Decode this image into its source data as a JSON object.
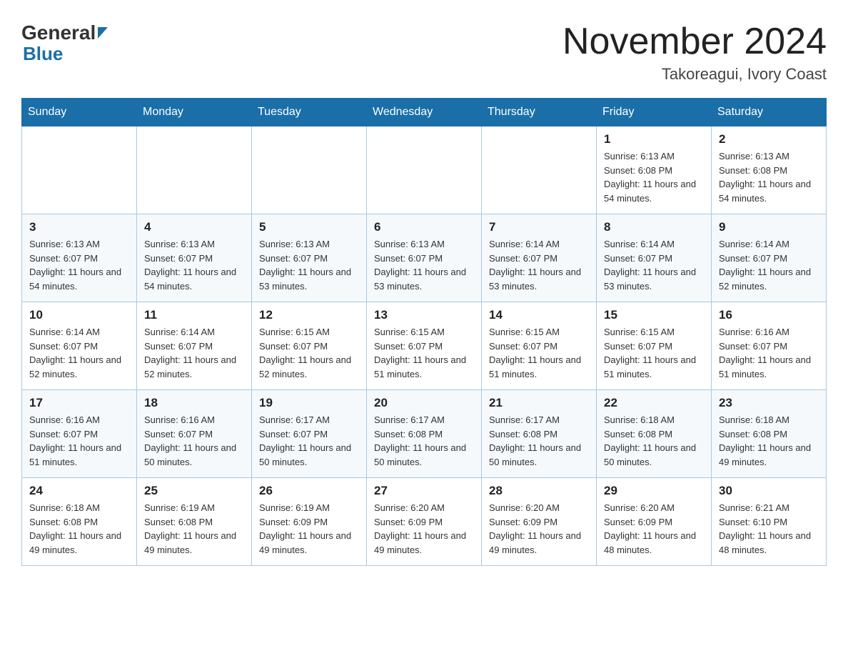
{
  "logo": {
    "general_text": "General",
    "blue_text": "Blue",
    "triangle_color": "#1a6fa8"
  },
  "header": {
    "month_year": "November 2024",
    "location": "Takoreagui, Ivory Coast"
  },
  "weekdays": [
    "Sunday",
    "Monday",
    "Tuesday",
    "Wednesday",
    "Thursday",
    "Friday",
    "Saturday"
  ],
  "weeks": [
    [
      {
        "day": "",
        "sunrise": "",
        "sunset": "",
        "daylight": ""
      },
      {
        "day": "",
        "sunrise": "",
        "sunset": "",
        "daylight": ""
      },
      {
        "day": "",
        "sunrise": "",
        "sunset": "",
        "daylight": ""
      },
      {
        "day": "",
        "sunrise": "",
        "sunset": "",
        "daylight": ""
      },
      {
        "day": "",
        "sunrise": "",
        "sunset": "",
        "daylight": ""
      },
      {
        "day": "1",
        "sunrise": "Sunrise: 6:13 AM",
        "sunset": "Sunset: 6:08 PM",
        "daylight": "Daylight: 11 hours and 54 minutes."
      },
      {
        "day": "2",
        "sunrise": "Sunrise: 6:13 AM",
        "sunset": "Sunset: 6:08 PM",
        "daylight": "Daylight: 11 hours and 54 minutes."
      }
    ],
    [
      {
        "day": "3",
        "sunrise": "Sunrise: 6:13 AM",
        "sunset": "Sunset: 6:07 PM",
        "daylight": "Daylight: 11 hours and 54 minutes."
      },
      {
        "day": "4",
        "sunrise": "Sunrise: 6:13 AM",
        "sunset": "Sunset: 6:07 PM",
        "daylight": "Daylight: 11 hours and 54 minutes."
      },
      {
        "day": "5",
        "sunrise": "Sunrise: 6:13 AM",
        "sunset": "Sunset: 6:07 PM",
        "daylight": "Daylight: 11 hours and 53 minutes."
      },
      {
        "day": "6",
        "sunrise": "Sunrise: 6:13 AM",
        "sunset": "Sunset: 6:07 PM",
        "daylight": "Daylight: 11 hours and 53 minutes."
      },
      {
        "day": "7",
        "sunrise": "Sunrise: 6:14 AM",
        "sunset": "Sunset: 6:07 PM",
        "daylight": "Daylight: 11 hours and 53 minutes."
      },
      {
        "day": "8",
        "sunrise": "Sunrise: 6:14 AM",
        "sunset": "Sunset: 6:07 PM",
        "daylight": "Daylight: 11 hours and 53 minutes."
      },
      {
        "day": "9",
        "sunrise": "Sunrise: 6:14 AM",
        "sunset": "Sunset: 6:07 PM",
        "daylight": "Daylight: 11 hours and 52 minutes."
      }
    ],
    [
      {
        "day": "10",
        "sunrise": "Sunrise: 6:14 AM",
        "sunset": "Sunset: 6:07 PM",
        "daylight": "Daylight: 11 hours and 52 minutes."
      },
      {
        "day": "11",
        "sunrise": "Sunrise: 6:14 AM",
        "sunset": "Sunset: 6:07 PM",
        "daylight": "Daylight: 11 hours and 52 minutes."
      },
      {
        "day": "12",
        "sunrise": "Sunrise: 6:15 AM",
        "sunset": "Sunset: 6:07 PM",
        "daylight": "Daylight: 11 hours and 52 minutes."
      },
      {
        "day": "13",
        "sunrise": "Sunrise: 6:15 AM",
        "sunset": "Sunset: 6:07 PM",
        "daylight": "Daylight: 11 hours and 51 minutes."
      },
      {
        "day": "14",
        "sunrise": "Sunrise: 6:15 AM",
        "sunset": "Sunset: 6:07 PM",
        "daylight": "Daylight: 11 hours and 51 minutes."
      },
      {
        "day": "15",
        "sunrise": "Sunrise: 6:15 AM",
        "sunset": "Sunset: 6:07 PM",
        "daylight": "Daylight: 11 hours and 51 minutes."
      },
      {
        "day": "16",
        "sunrise": "Sunrise: 6:16 AM",
        "sunset": "Sunset: 6:07 PM",
        "daylight": "Daylight: 11 hours and 51 minutes."
      }
    ],
    [
      {
        "day": "17",
        "sunrise": "Sunrise: 6:16 AM",
        "sunset": "Sunset: 6:07 PM",
        "daylight": "Daylight: 11 hours and 51 minutes."
      },
      {
        "day": "18",
        "sunrise": "Sunrise: 6:16 AM",
        "sunset": "Sunset: 6:07 PM",
        "daylight": "Daylight: 11 hours and 50 minutes."
      },
      {
        "day": "19",
        "sunrise": "Sunrise: 6:17 AM",
        "sunset": "Sunset: 6:07 PM",
        "daylight": "Daylight: 11 hours and 50 minutes."
      },
      {
        "day": "20",
        "sunrise": "Sunrise: 6:17 AM",
        "sunset": "Sunset: 6:08 PM",
        "daylight": "Daylight: 11 hours and 50 minutes."
      },
      {
        "day": "21",
        "sunrise": "Sunrise: 6:17 AM",
        "sunset": "Sunset: 6:08 PM",
        "daylight": "Daylight: 11 hours and 50 minutes."
      },
      {
        "day": "22",
        "sunrise": "Sunrise: 6:18 AM",
        "sunset": "Sunset: 6:08 PM",
        "daylight": "Daylight: 11 hours and 50 minutes."
      },
      {
        "day": "23",
        "sunrise": "Sunrise: 6:18 AM",
        "sunset": "Sunset: 6:08 PM",
        "daylight": "Daylight: 11 hours and 49 minutes."
      }
    ],
    [
      {
        "day": "24",
        "sunrise": "Sunrise: 6:18 AM",
        "sunset": "Sunset: 6:08 PM",
        "daylight": "Daylight: 11 hours and 49 minutes."
      },
      {
        "day": "25",
        "sunrise": "Sunrise: 6:19 AM",
        "sunset": "Sunset: 6:08 PM",
        "daylight": "Daylight: 11 hours and 49 minutes."
      },
      {
        "day": "26",
        "sunrise": "Sunrise: 6:19 AM",
        "sunset": "Sunset: 6:09 PM",
        "daylight": "Daylight: 11 hours and 49 minutes."
      },
      {
        "day": "27",
        "sunrise": "Sunrise: 6:20 AM",
        "sunset": "Sunset: 6:09 PM",
        "daylight": "Daylight: 11 hours and 49 minutes."
      },
      {
        "day": "28",
        "sunrise": "Sunrise: 6:20 AM",
        "sunset": "Sunset: 6:09 PM",
        "daylight": "Daylight: 11 hours and 49 minutes."
      },
      {
        "day": "29",
        "sunrise": "Sunrise: 6:20 AM",
        "sunset": "Sunset: 6:09 PM",
        "daylight": "Daylight: 11 hours and 48 minutes."
      },
      {
        "day": "30",
        "sunrise": "Sunrise: 6:21 AM",
        "sunset": "Sunset: 6:10 PM",
        "daylight": "Daylight: 11 hours and 48 minutes."
      }
    ]
  ]
}
